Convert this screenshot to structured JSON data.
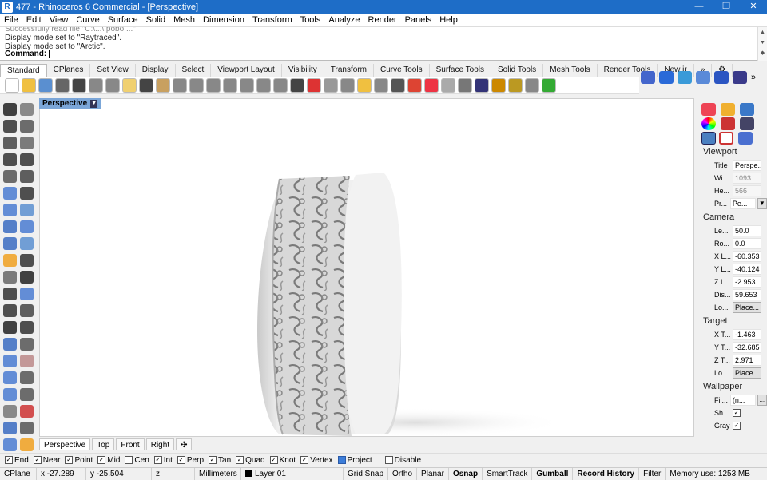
{
  "window": {
    "title": "477 - Rhinoceros 6 Commercial - [Perspective]",
    "minimize": "—",
    "restore": "❐",
    "close": "✕"
  },
  "menu": [
    "File",
    "Edit",
    "View",
    "Curve",
    "Surface",
    "Solid",
    "Mesh",
    "Dimension",
    "Transform",
    "Tools",
    "Analyze",
    "Render",
    "Panels",
    "Help"
  ],
  "command": {
    "history": [
      "Successfully read file \"C:\\...\\ pobo ...\"",
      "Display mode set to \"Raytraced\".",
      "Display mode set to \"Arctic\"."
    ],
    "prompt": "Command:"
  },
  "tabs": [
    "Standard",
    "CPlanes",
    "Set View",
    "Display",
    "Select",
    "Viewport Layout",
    "Visibility",
    "Transform",
    "Curve Tools",
    "Surface Tools",
    "Solid Tools",
    "Mesh Tools",
    "Render Tools",
    "New ir"
  ],
  "active_tab": "Standard",
  "viewport": {
    "label": "Perspective"
  },
  "view_tabs": [
    "Perspective",
    "Top",
    "Front",
    "Right"
  ],
  "view_tab_add": "✣",
  "osnaps": [
    {
      "label": "End",
      "checked": true
    },
    {
      "label": "Near",
      "checked": true
    },
    {
      "label": "Point",
      "checked": true
    },
    {
      "label": "Mid",
      "checked": true
    },
    {
      "label": "Cen",
      "checked": false
    },
    {
      "label": "Int",
      "checked": true
    },
    {
      "label": "Perp",
      "checked": true
    },
    {
      "label": "Tan",
      "checked": true
    },
    {
      "label": "Quad",
      "checked": true
    },
    {
      "label": "Knot",
      "checked": true
    },
    {
      "label": "Vertex",
      "checked": true
    },
    {
      "label": "Project",
      "checked": false
    },
    {
      "label": "Disable",
      "checked": false
    }
  ],
  "status": {
    "cplane": "CPlane",
    "x": "x -27.289",
    "y": "y -25.504",
    "z": "z",
    "units": "Millimeters",
    "layer": "Layer 01",
    "grid_snap": "Grid Snap",
    "ortho": "Ortho",
    "planar": "Planar",
    "osnap": "Osnap",
    "smarttrack": "SmartTrack",
    "gumball": "Gumball",
    "record_history": "Record History",
    "filter": "Filter",
    "memory": "Memory use: 1253 MB"
  },
  "panel": {
    "viewport_header": "Viewport",
    "viewport_rows": [
      {
        "label": "Title",
        "value": "Perspe...",
        "grey": false
      },
      {
        "label": "Wi...",
        "value": "1093",
        "grey": true
      },
      {
        "label": "He...",
        "value": "566",
        "grey": true
      },
      {
        "label": "Pr...",
        "value": "Pe...",
        "grey": false,
        "dropdown": true
      }
    ],
    "camera_header": "Camera",
    "camera_rows": [
      {
        "label": "Le...",
        "value": "50.0"
      },
      {
        "label": "Ro...",
        "value": "0.0"
      },
      {
        "label": "X L...",
        "value": "-60.353"
      },
      {
        "label": "Y L...",
        "value": "-40.124"
      },
      {
        "label": "Z L...",
        "value": "-2.953"
      },
      {
        "label": "Dis...",
        "value": "59.653"
      },
      {
        "label": "Lo...",
        "button": "Place..."
      }
    ],
    "target_header": "Target",
    "target_rows": [
      {
        "label": "X T...",
        "value": "-1.463"
      },
      {
        "label": "Y T...",
        "value": "-32.685"
      },
      {
        "label": "Z T...",
        "value": "2.971"
      },
      {
        "label": "Lo...",
        "button": "Place..."
      }
    ],
    "wallpaper_header": "Wallpaper",
    "wallpaper_rows": [
      {
        "label": "Fil...",
        "value": "(n...",
        "mini": "..."
      },
      {
        "label": "Sh...",
        "check": true
      },
      {
        "label": "Gray",
        "check": true
      }
    ]
  },
  "colors": {
    "titlebar": "#1e6dc7",
    "viewport_label": "#7ba6d8",
    "accent": "#3c7dd9"
  }
}
